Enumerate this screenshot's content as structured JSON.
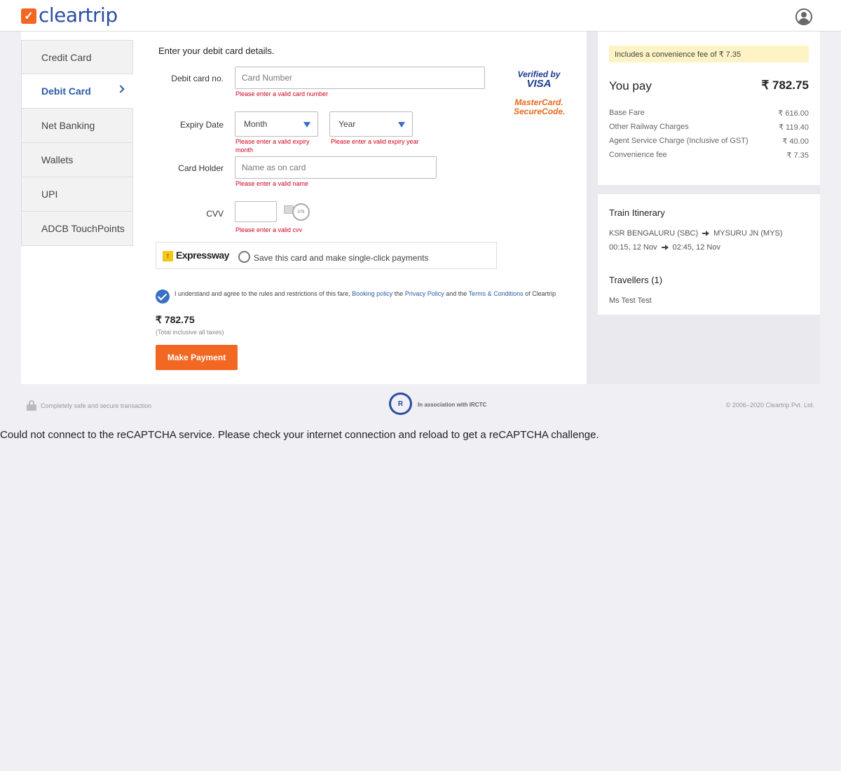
{
  "header": {
    "logo_mark": "✓",
    "logo_text": "cleartrip",
    "profile_icon": "user-icon"
  },
  "tabs": [
    {
      "label": "Credit Card",
      "active": false
    },
    {
      "label": "Debit Card",
      "active": true
    },
    {
      "label": "Net Banking",
      "active": false
    },
    {
      "label": "Wallets",
      "active": false
    },
    {
      "label": "UPI",
      "active": false
    },
    {
      "label": "ADCB TouchPoints",
      "active": false
    }
  ],
  "form": {
    "title": "Enter your debit card details.",
    "card_no_label": "Debit card no.",
    "card_no_placeholder": "Card Number",
    "card_no_error": "Please enter a valid card number",
    "expiry_label": "Expiry Date",
    "month_value": "Month",
    "year_value": "Year",
    "month_error_1": "Please enter a valid expiry",
    "month_error_2": "month",
    "year_error": "Please enter a valid expiry year",
    "holder_label": "Card Holder",
    "holder_placeholder": "Name as on card",
    "holder_error": "Please enter a valid name",
    "cvv_label": "CVV",
    "cvv_error": "Please enter a valid cvv",
    "cvv_hint": "376",
    "verified_by_visa_1": "Verified by",
    "verified_by_visa_2": "VISA",
    "mastercard_1": "MasterCard.",
    "mastercard_2": "SecureCode."
  },
  "expressway": {
    "brand": "Expressway",
    "save_text": "Save this card and make single-click payments"
  },
  "terms": {
    "prefix": "I understand and agree to the rules and restrictions of this fare, ",
    "booking_policy": "Booking policy",
    "mid1": " the ",
    "privacy_policy": "Privacy Policy",
    "mid2": " and the ",
    "terms_conditions": "Terms & Conditions",
    "suffix": " of Cleartrip",
    "checked": true
  },
  "total": {
    "amount": "₹ 782.75",
    "note": "(Total inclusive all taxes)",
    "pay_button": "Make Payment"
  },
  "fare": {
    "convenience_note": "Includes a convenience fee of ₹ 7.35",
    "you_pay_label": "You pay",
    "you_pay_amount": "₹ 782.75",
    "rows": [
      {
        "label": "Base Fare",
        "value": "₹ 616.00"
      },
      {
        "label": "Other Railway Charges",
        "value": "₹ 119.40"
      },
      {
        "label": "Agent Service Charge (Inclusive of GST)",
        "value": "₹ 40.00"
      },
      {
        "label": "Convenience fee",
        "value": "₹ 7.35"
      }
    ]
  },
  "itinerary": {
    "title": "Train Itinerary",
    "from": "KSR BENGALURU (SBC)",
    "to": "MYSURU JN (MYS)",
    "depart": "00:15, 12 Nov",
    "arrive": "02:45, 12 Nov",
    "travellers_title": "Travellers (1)",
    "traveller": "Ms Test Test"
  },
  "footer": {
    "secure": "Completely safe and secure transaction",
    "irctc": "In association with IRCTC",
    "irctc_mark": "R",
    "copyright": "© 2006–2020 Cleartrip Pvt. Ltd."
  },
  "recaptcha_message": "Could not connect to the reCAPTCHA service. Please check your internet connection and reload to get a reCAPTCHA challenge.",
  "colors": {
    "brand_orange": "#f26722",
    "brand_blue": "#2a4ea2",
    "error_red": "#d0021b",
    "link_blue": "#2a5ca8"
  }
}
